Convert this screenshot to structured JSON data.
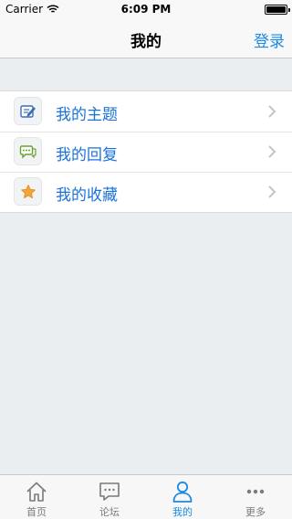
{
  "status_bar": {
    "carrier": "Carrier",
    "time": "6:09 PM"
  },
  "nav": {
    "title": "我的",
    "login_label": "登录"
  },
  "menu": {
    "items": [
      {
        "label": "我的主题",
        "icon": "edit-topic-icon"
      },
      {
        "label": "我的回复",
        "icon": "reply-bubble-icon"
      },
      {
        "label": "我的收藏",
        "icon": "star-icon"
      }
    ]
  },
  "tabs": [
    {
      "label": "首页",
      "icon": "home-icon",
      "active": false
    },
    {
      "label": "论坛",
      "icon": "forum-chat-icon",
      "active": false
    },
    {
      "label": "我的",
      "icon": "user-icon",
      "active": true
    },
    {
      "label": "更多",
      "icon": "more-dots-icon",
      "active": false
    }
  ],
  "colors": {
    "accent": "#1a8ae5",
    "label_blue": "#1a73d9",
    "background": "#eaeef1"
  }
}
